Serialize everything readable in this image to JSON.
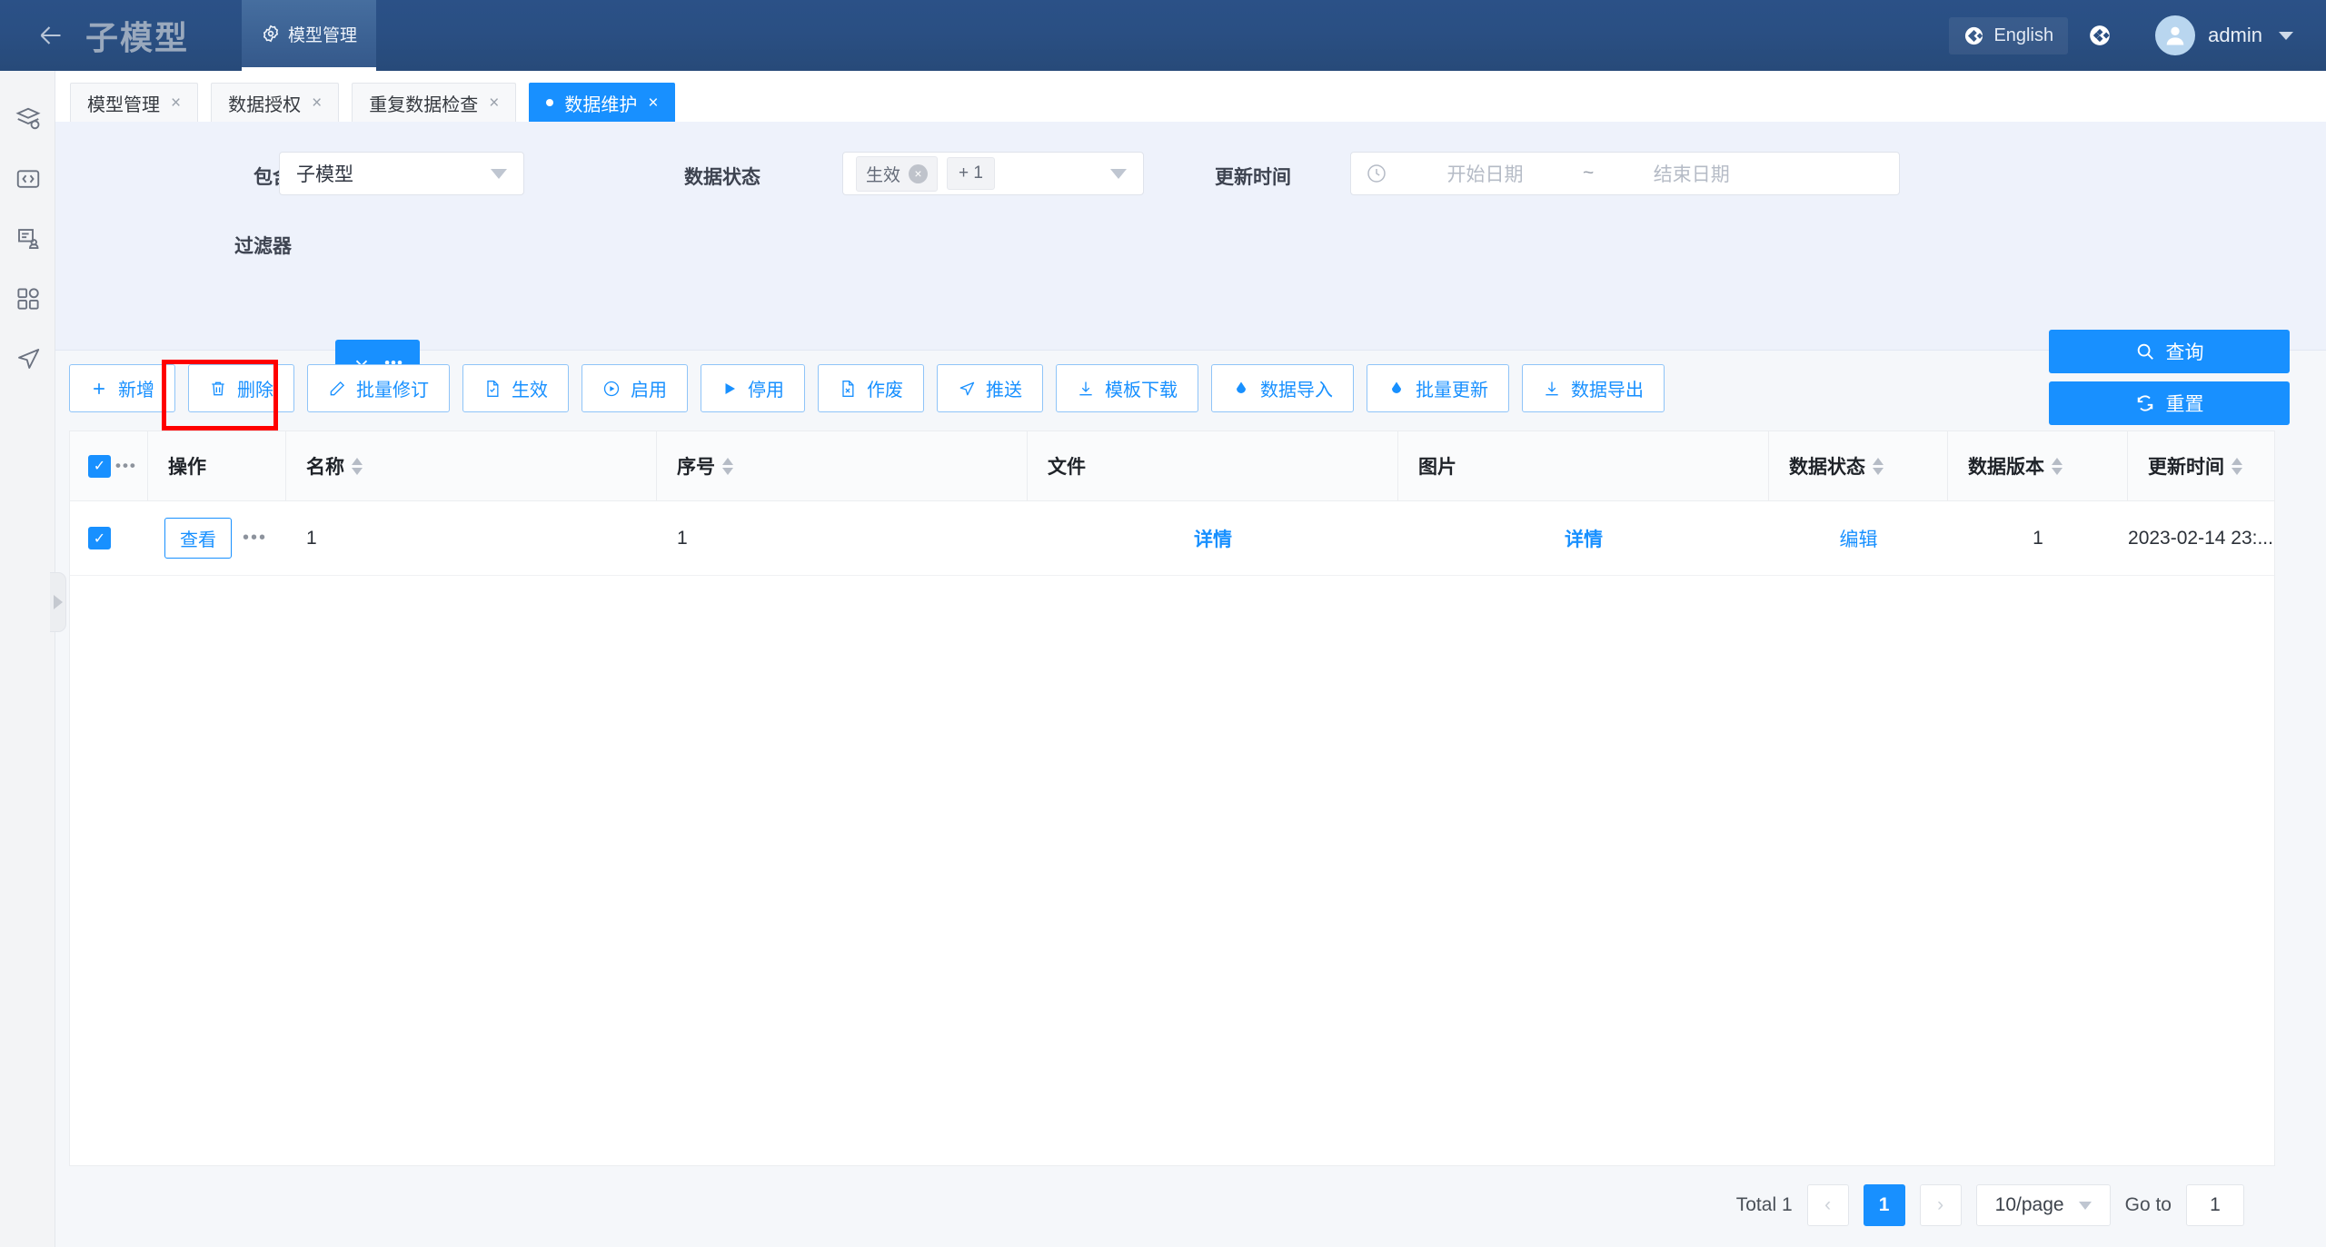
{
  "header": {
    "back_icon": "arrow-left-icon",
    "app_title": "子模型",
    "module": {
      "icon": "gear-icon",
      "label": "模型管理"
    },
    "language": {
      "icon": "globe-icon",
      "label": "English"
    },
    "theme_icon": "theme-toggle-icon",
    "user": {
      "avatar_icon": "user-avatar-icon",
      "name": "admin",
      "caret": "chevron-down-icon"
    }
  },
  "sidebar": {
    "items": [
      {
        "icon": "database-layers-icon",
        "name": "data-models"
      },
      {
        "icon": "code-brackets-icon",
        "name": "code-editor"
      },
      {
        "icon": "document-user-icon",
        "name": "data-authorization"
      },
      {
        "icon": "apps-grid-icon",
        "name": "applications"
      },
      {
        "icon": "paper-plane-icon",
        "name": "publish"
      }
    ],
    "collapse_handle_icon": "triangle-right-icon"
  },
  "tabs": [
    {
      "label": "模型管理",
      "active": false,
      "close": "×"
    },
    {
      "label": "数据授权",
      "active": false,
      "close": "×"
    },
    {
      "label": "重复数据检查",
      "active": false,
      "close": "×"
    },
    {
      "label": "数据维护",
      "active": true,
      "close": "×"
    }
  ],
  "filters": {
    "contains": {
      "label": "包含",
      "value": "子模型",
      "chevron": "chevron-down-icon"
    },
    "data_status": {
      "label": "数据状态",
      "tag": "生效",
      "tag_close": "×",
      "more": "+ 1",
      "chevron": "chevron-down-icon"
    },
    "update_time": {
      "label": "更新时间",
      "clock_icon": "clock-icon",
      "start_placeholder": "开始日期",
      "separator": "~",
      "end_placeholder": "结束日期"
    },
    "filter_group": {
      "label": "过滤器",
      "chevron": "chevron-down-icon",
      "dots": "•••"
    },
    "query_button": {
      "icon": "search-icon",
      "label": "查询"
    },
    "reset_button": {
      "icon": "refresh-icon",
      "label": "重置"
    }
  },
  "toolbar": [
    {
      "icon": "plus-icon",
      "label": "新增",
      "name": "add-button"
    },
    {
      "icon": "trash-icon",
      "label": "删除",
      "name": "delete-button",
      "highlighted": true
    },
    {
      "icon": "pencil-icon",
      "label": "批量修订",
      "name": "batch-revise-button"
    },
    {
      "icon": "file-check-icon",
      "label": "生效",
      "name": "activate-button"
    },
    {
      "icon": "play-circle-icon",
      "label": "启用",
      "name": "enable-button"
    },
    {
      "icon": "play-icon",
      "label": "停用",
      "name": "disable-button"
    },
    {
      "icon": "file-x-icon",
      "label": "作废",
      "name": "void-button"
    },
    {
      "icon": "send-icon",
      "label": "推送",
      "name": "push-button"
    },
    {
      "icon": "download-icon",
      "label": "模板下载",
      "name": "template-download-button"
    },
    {
      "icon": "cloud-upload-icon",
      "label": "数据导入",
      "name": "data-import-button"
    },
    {
      "icon": "cloud-upload-icon",
      "label": "批量更新",
      "name": "batch-update-button"
    },
    {
      "icon": "download-icon",
      "label": "数据导出",
      "name": "data-export-button"
    }
  ],
  "table": {
    "columns": [
      {
        "label": "",
        "sortable": false,
        "name": "select-all"
      },
      {
        "label": "操作",
        "sortable": false,
        "name": "column-operation"
      },
      {
        "label": "名称",
        "sortable": true,
        "name": "column-name"
      },
      {
        "label": "序号",
        "sortable": true,
        "name": "column-seq"
      },
      {
        "label": "文件",
        "sortable": false,
        "name": "column-file"
      },
      {
        "label": "图片",
        "sortable": false,
        "name": "column-image"
      },
      {
        "label": "数据状态",
        "sortable": true,
        "name": "column-data-status"
      },
      {
        "label": "数据版本",
        "sortable": true,
        "name": "column-data-version"
      },
      {
        "label": "更新时间",
        "sortable": true,
        "name": "column-update-time"
      }
    ],
    "header_dots": "•••",
    "rows": [
      {
        "checked": true,
        "action_label": "查看",
        "row_dots": "•••",
        "name": "1",
        "seq": "1",
        "file": "详情",
        "image": "详情",
        "data_status": "编辑",
        "data_version": "1",
        "update_time": "2023-02-14 23:..."
      }
    ]
  },
  "pagination": {
    "total": "Total 1",
    "prev": "‹",
    "current_page": "1",
    "next": "›",
    "page_size": "10/page",
    "goto_label": "Go to",
    "goto_value": "1"
  },
  "colors": {
    "primary": "#1890ff",
    "header_blue": "#2a4f83",
    "highlight_red": "#ff0000"
  }
}
